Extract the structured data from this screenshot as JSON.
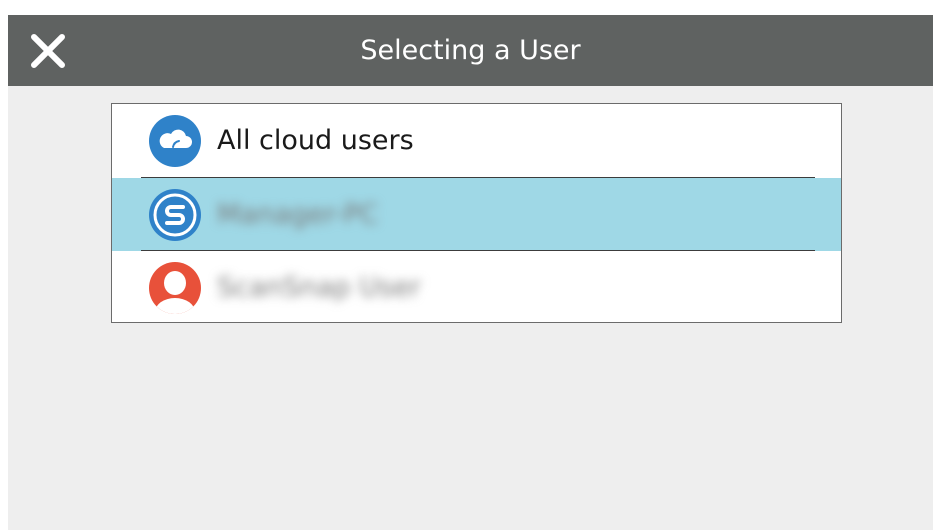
{
  "window": {
    "title": "Selecting a User"
  },
  "users": [
    {
      "label": "All cloud users",
      "icon": "cloud-icon",
      "selected": false,
      "blurred": false
    },
    {
      "label": "Manager-PC",
      "icon": "scansnap-logo-icon",
      "selected": true,
      "blurred": true
    },
    {
      "label": "ScanSnap User",
      "icon": "person-icon",
      "selected": false,
      "blurred": true
    }
  ],
  "colors": {
    "titlebar": "#5f6261",
    "background": "#eeeeee",
    "selection": "#9fd8e6",
    "cloud_icon": "#2f82c9",
    "scansnap_icon": "#2f82c9",
    "person_icon": "#e8513a"
  }
}
